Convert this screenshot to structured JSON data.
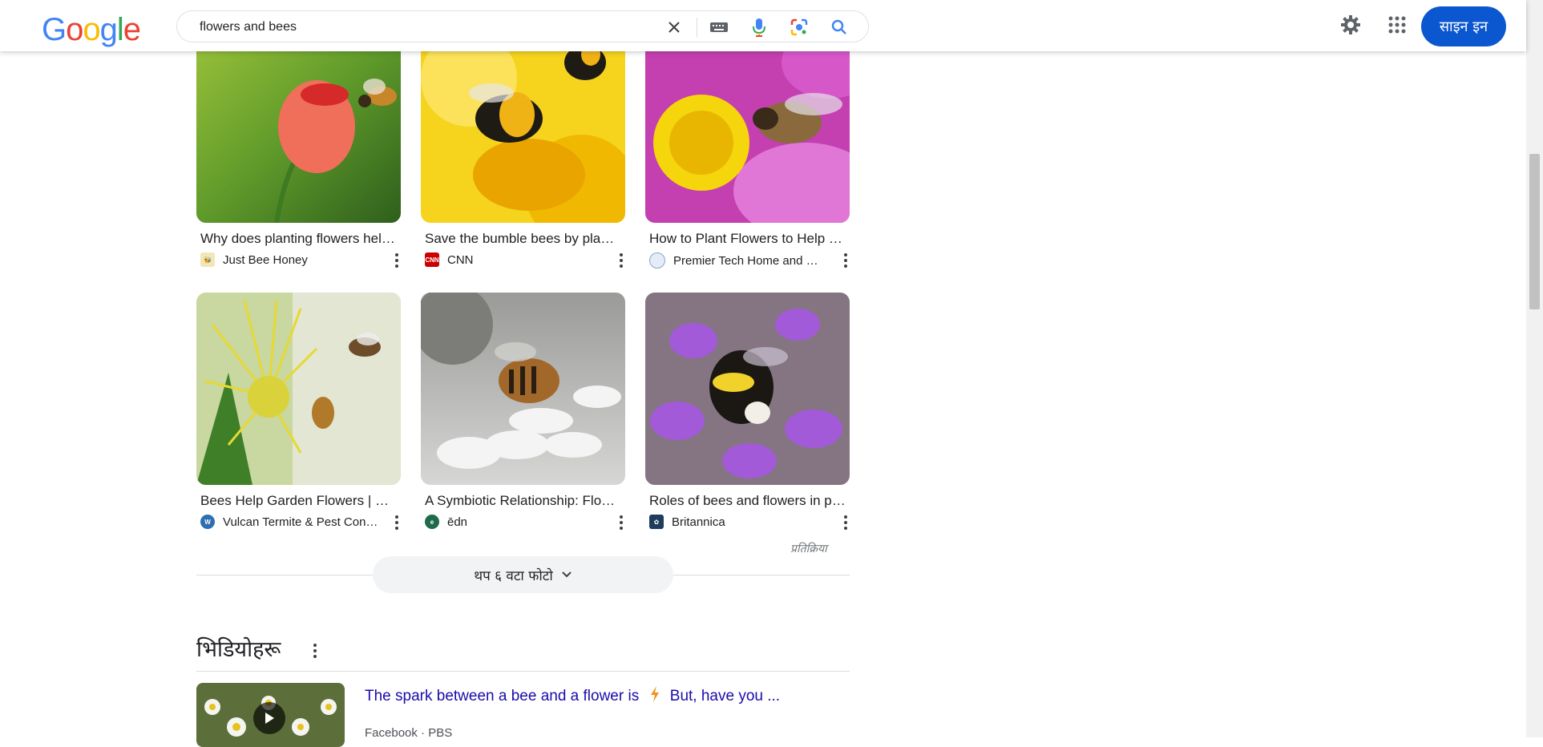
{
  "header": {
    "logo_letters": [
      "G",
      "o",
      "o",
      "g",
      "l",
      "e"
    ],
    "search_query": "flowers and bees",
    "signin_label": "साइन इन"
  },
  "colors": {
    "google_blue": "#4285f4",
    "google_red": "#ea4335",
    "google_yellow": "#fbbc05",
    "google_green": "#34a853",
    "signin_bg": "#0b57d0",
    "link_blue": "#1a0dab"
  },
  "icons": [
    "clear-icon",
    "keyboard-icon",
    "mic-icon",
    "lens-icon",
    "search-icon",
    "settings-gear-icon",
    "apps-grid-icon",
    "more-options-icon",
    "chevron-down-icon",
    "play-icon",
    "lightning-emoji-icon"
  ],
  "images": [
    {
      "title": "Why does planting flowers help bees?",
      "source": "Just Bee Honey"
    },
    {
      "title": "Save the bumble bees by planting flowers",
      "source": "CNN"
    },
    {
      "title": "How to Plant Flowers to Help Bees",
      "source": "Premier Tech Home and Garden"
    },
    {
      "title": "Bees Help Garden Flowers | Vulcan",
      "source": "Vulcan Termite & Pest Control"
    },
    {
      "title": "A Symbiotic Relationship: Flowers and Bees",
      "source": "ēdn"
    },
    {
      "title": "Roles of bees and flowers in pollination",
      "source": "Britannica"
    }
  ],
  "feedback_label": "प्रतिक्रिया",
  "more_photos_label": "थप ६ वटा फोटो",
  "videos": {
    "heading": "भिडियोहरू",
    "items": [
      {
        "title_part1": "The spark between a bee and a flower is",
        "title_part2": "But, have you ...",
        "source": "Facebook · PBS"
      }
    ]
  }
}
